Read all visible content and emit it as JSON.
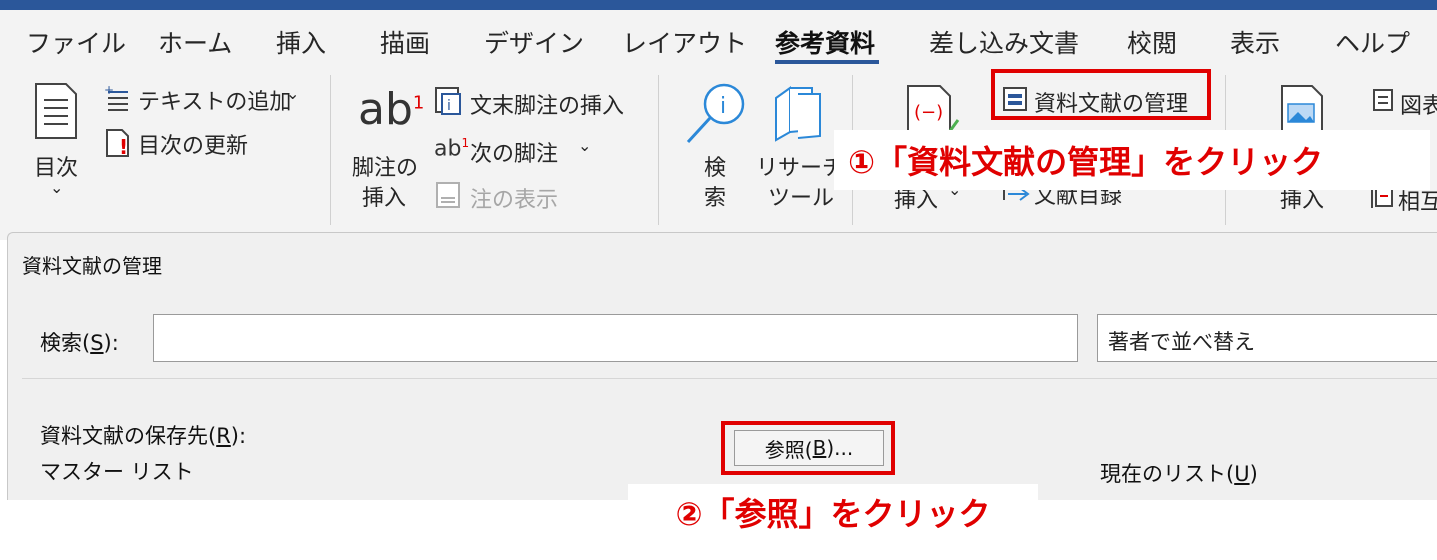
{
  "tabs": [
    "ファイル",
    "ホーム",
    "挿入",
    "描画",
    "デザイン",
    "レイアウト",
    "参考資料",
    "差し込み文書",
    "校閲",
    "表示",
    "ヘルプ"
  ],
  "active_tab": "参考資料",
  "ribbon": {
    "toc_label": "目次",
    "add_text_label": "テキストの追加",
    "update_toc_label": "目次の更新",
    "footnote_insert_label_1": "脚注の",
    "footnote_insert_label_2": "挿入",
    "endnote_insert_label": "文末脚注の挿入",
    "next_footnote_label": "次の脚注",
    "show_notes_label": "注の表示",
    "search_label_1": "検",
    "search_label_2": "索",
    "researcher_label_1": "リサーチ",
    "researcher_label_2": "ツール",
    "manage_sources_label": "資料文献の管理",
    "citation_insert_label": "挿入",
    "bibliography_label": "文献目録",
    "caption_insert_label": "挿入",
    "figure_label": "図表",
    "cross_ref_label": "相互"
  },
  "callouts": {
    "step1": "①「資料文献の管理」をクリック",
    "step2": "②「参照」をクリック"
  },
  "dialog": {
    "title": "資料文献の管理",
    "search_label_prefix": "検索(",
    "search_label_key": "S",
    "search_label_suffix": "):",
    "search_value": "",
    "sort_value": "著者で並べ替え",
    "save_location_prefix": "資料文献の保存先(",
    "save_location_key": "R",
    "save_location_suffix": "):",
    "browse_prefix": "参照(",
    "browse_key": "B",
    "browse_suffix": ")...",
    "master_list_label": "マスター リスト",
    "current_list_prefix": "現在のリスト(",
    "current_list_key": "U",
    "current_list_suffix": ")"
  },
  "colors": {
    "accent": "#2b579a",
    "highlight": "#e00000"
  }
}
